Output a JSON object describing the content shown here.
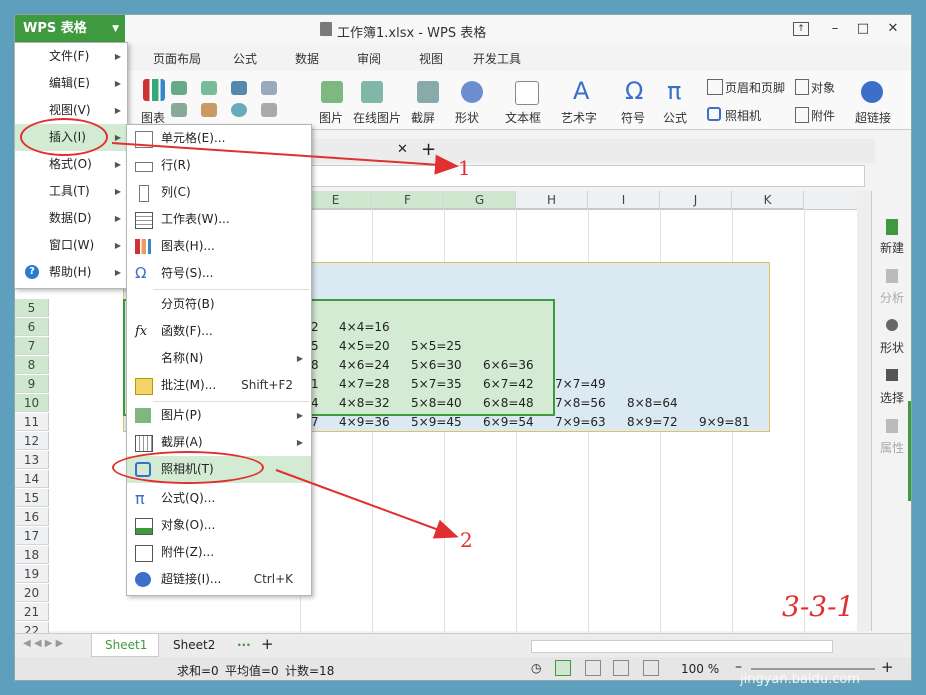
{
  "window": {
    "app_button": "WPS 表格",
    "title": "工作簿1.xlsx - WPS 表格"
  },
  "ribbon_tabs": [
    "页面布局",
    "公式",
    "数据",
    "审阅",
    "视图",
    "开发工具"
  ],
  "ribbon": {
    "chart": "图表",
    "picture": "图片",
    "online_picture": "在线图片",
    "screenshot": "截屏",
    "shape": "形状",
    "textbox": "文本框",
    "wordart": "艺术字",
    "symbol": "符号",
    "formula": "公式",
    "header_footer": "页眉和页脚",
    "camera": "照相机",
    "object": "对象",
    "attachment": "附件",
    "hyperlink": "超链接"
  },
  "columns": [
    "E",
    "F",
    "G",
    "H",
    "I",
    "J",
    "K"
  ],
  "rows": [
    "5",
    "6",
    "7",
    "8",
    "9",
    "10",
    "11",
    "12",
    "13",
    "14",
    "15",
    "16",
    "17",
    "18",
    "19",
    "20",
    "21",
    "22"
  ],
  "cells": {
    "r5": [
      "2",
      "4×4=16"
    ],
    "r6": [
      "5",
      "4×5=20",
      "5×5=25"
    ],
    "r7": [
      "8",
      "4×6=24",
      "5×6=30",
      "6×6=36"
    ],
    "r8": [
      "1",
      "4×7=28",
      "5×7=35",
      "6×7=42",
      "7×7=49"
    ],
    "r9": [
      "4",
      "4×8=32",
      "5×8=40",
      "6×8=48",
      "7×8=56",
      "8×8=64"
    ],
    "r10": [
      "7",
      "4×9=36",
      "5×9=45",
      "6×9=54",
      "7×9=63",
      "8×9=72",
      "9×9=81"
    ]
  },
  "main_menu": [
    {
      "label": "文件(F)"
    },
    {
      "label": "编辑(E)"
    },
    {
      "label": "视图(V)"
    },
    {
      "label": "插入(I)"
    },
    {
      "label": "格式(O)"
    },
    {
      "label": "工具(T)"
    },
    {
      "label": "数据(D)"
    },
    {
      "label": "窗口(W)"
    },
    {
      "label": "帮助(H)"
    }
  ],
  "insert_menu": [
    {
      "label": "单元格(E)...",
      "icon": "cell-icon"
    },
    {
      "label": "行(R)",
      "icon": "row-icon"
    },
    {
      "label": "列(C)",
      "icon": "column-icon"
    },
    {
      "label": "工作表(W)...",
      "icon": "worksheet-icon"
    },
    {
      "label": "图表(H)...",
      "icon": "chart-icon"
    },
    {
      "label": "符号(S)...",
      "icon": "omega-icon"
    },
    {
      "label": "分页符(B)"
    },
    {
      "label": "函数(F)...",
      "icon": "fx-icon"
    },
    {
      "label": "名称(N)"
    },
    {
      "label": "批注(M)...",
      "shortcut": "Shift+F2",
      "icon": "comment-icon"
    },
    {
      "label": "图片(P)",
      "icon": "picture-icon"
    },
    {
      "label": "截屏(A)",
      "icon": "screenshot-icon"
    },
    {
      "label": "照相机(T)",
      "icon": "camera-icon"
    },
    {
      "label": "公式(Q)...",
      "icon": "pi-icon"
    },
    {
      "label": "对象(O)...",
      "icon": "object-icon"
    },
    {
      "label": "附件(Z)...",
      "icon": "attachment-icon"
    },
    {
      "label": "超链接(I)...",
      "shortcut": "Ctrl+K",
      "icon": "hyperlink-icon"
    }
  ],
  "right_panel": [
    "新建",
    "分析",
    "形状",
    "选择",
    "属性"
  ],
  "sheets": [
    "Sheet1",
    "Sheet2"
  ],
  "status": {
    "sum": "求和=0",
    "avg": "平均值=0",
    "count": "计数=18",
    "zoom": "100 %"
  },
  "annotations": {
    "n1": "1",
    "n2": "2",
    "watermark_label": "3-3-1",
    "watermark_site": "jingyan.baidu.com"
  },
  "colors": {
    "accent": "#3f9a3f",
    "highlight": "#d3ead3",
    "annotation": "#e03030"
  }
}
